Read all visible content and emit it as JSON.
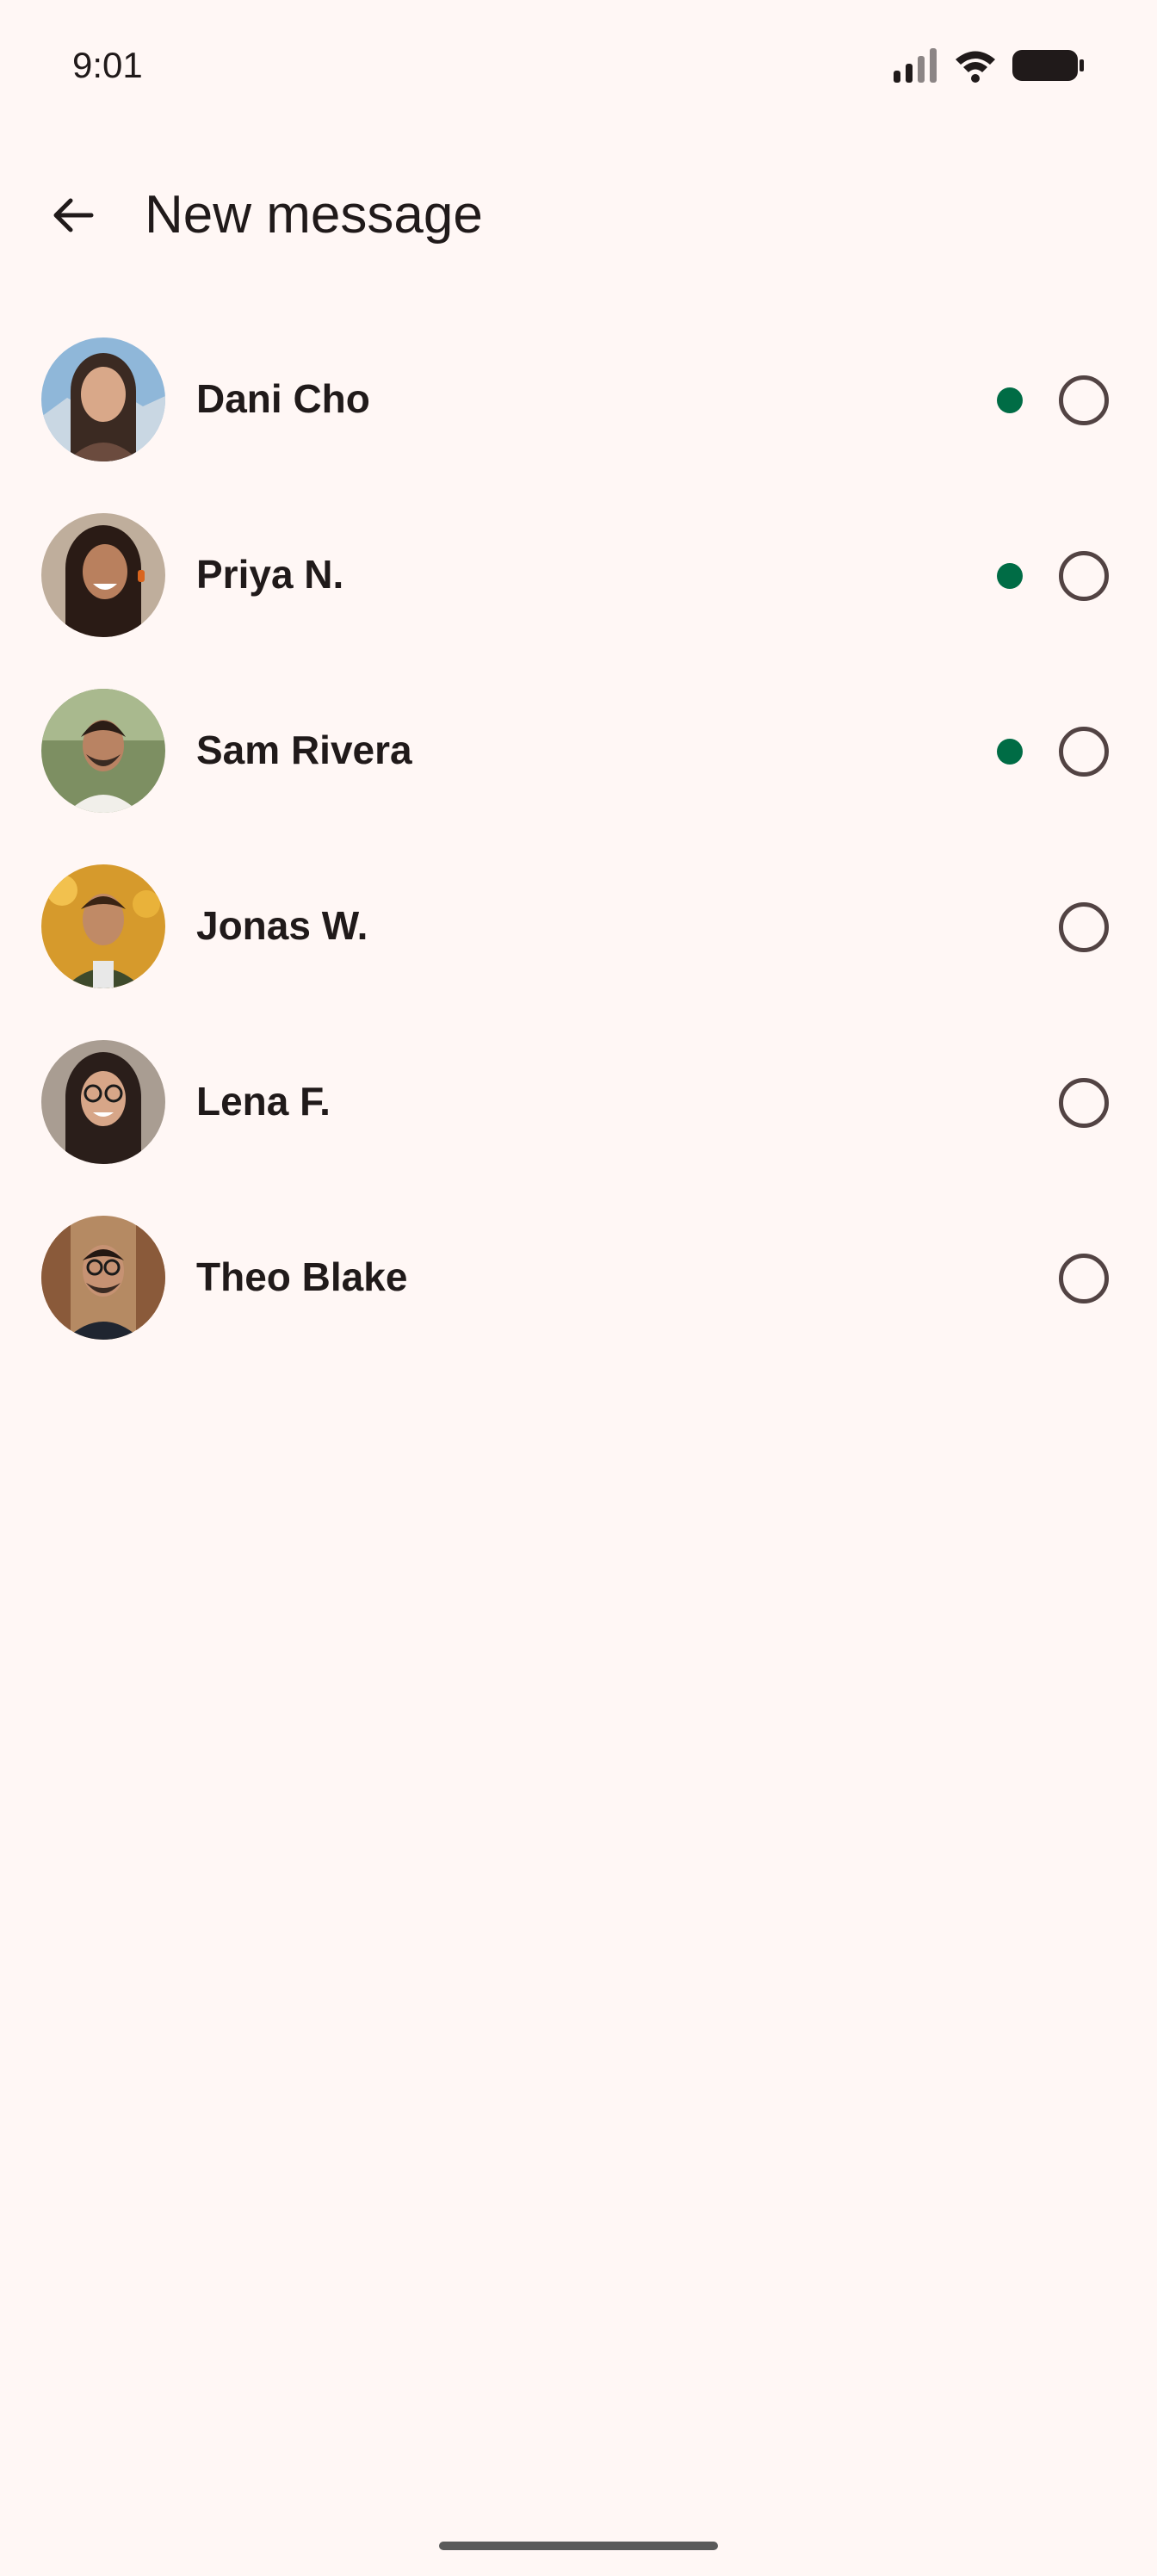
{
  "status_bar": {
    "time": "9:01",
    "icons": [
      "signal-icon",
      "wifi-icon",
      "battery-icon"
    ]
  },
  "app_bar": {
    "back_icon": "arrow-back-icon",
    "title": "New message"
  },
  "contacts": [
    {
      "name": "Dani Cho",
      "online": true,
      "selected": false
    },
    {
      "name": "Priya N.",
      "online": true,
      "selected": false
    },
    {
      "name": "Sam Rivera",
      "online": true,
      "selected": false
    },
    {
      "name": "Jonas W.",
      "online": false,
      "selected": false
    },
    {
      "name": "Lena F.",
      "online": false,
      "selected": false
    },
    {
      "name": "Theo Blake",
      "online": false,
      "selected": false
    }
  ],
  "colors": {
    "background": "#fff7f5",
    "text": "#201a1a",
    "online": "#006c45",
    "radio_outline": "#524343"
  }
}
